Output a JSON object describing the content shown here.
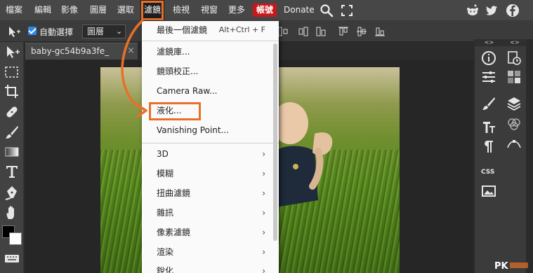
{
  "menubar": {
    "items": [
      {
        "label": "檔案",
        "name": "menu-file"
      },
      {
        "label": "編輯",
        "name": "menu-edit"
      },
      {
        "label": "影像",
        "name": "menu-image"
      },
      {
        "label": "圖層",
        "name": "menu-layer"
      },
      {
        "label": "選取",
        "name": "menu-select"
      },
      {
        "label": "濾鏡",
        "name": "menu-filter"
      },
      {
        "label": "檢視",
        "name": "menu-view"
      },
      {
        "label": "視窗",
        "name": "menu-window"
      },
      {
        "label": "更多",
        "name": "menu-more"
      }
    ],
    "account_label": "帳號",
    "donate_label": "Donate"
  },
  "options": {
    "auto_select_label": "自動選擇",
    "layer_select_value": "圖層"
  },
  "document": {
    "tab_title": "baby-gc54b9a3fe_",
    "close": "×"
  },
  "filter_menu": {
    "last_filter": {
      "label": "最後一個濾鏡",
      "shortcut": "Alt+Ctrl + F"
    },
    "items": [
      {
        "label": "濾鏡庫..."
      },
      {
        "label": "鏡頭校正..."
      },
      {
        "label": "Camera Raw..."
      },
      {
        "label": "液化..."
      },
      {
        "label": "Vanishing Point..."
      }
    ],
    "submenus": [
      {
        "label": "3D"
      },
      {
        "label": "模糊"
      },
      {
        "label": "扭曲濾鏡"
      },
      {
        "label": "雜訊"
      },
      {
        "label": "像素濾鏡"
      },
      {
        "label": "渲染"
      },
      {
        "label": "銳化"
      }
    ]
  },
  "right_panel": {
    "collapse_label": "<>",
    "css_label": "CSS"
  },
  "watermark": {
    "text": "PK"
  },
  "colors": {
    "accent": "#e8702a",
    "account": "#c8181d",
    "menubar": "#474747",
    "checkbox": "#2c8aeb"
  }
}
